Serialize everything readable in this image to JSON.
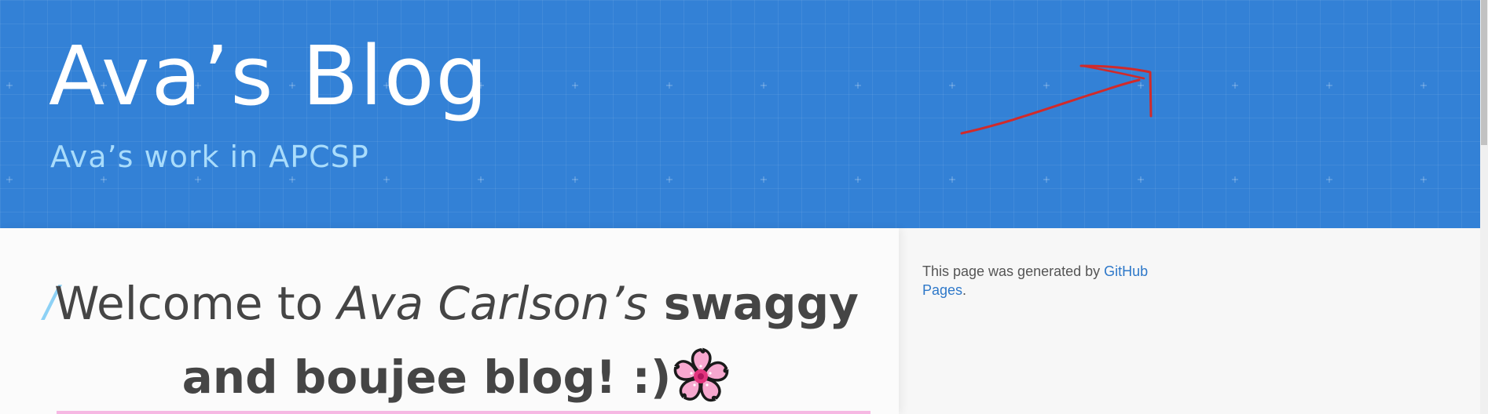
{
  "header": {
    "title": "Ava’s Blog",
    "subtitle": "Ava’s work in APCSP",
    "background_color": "#3381d6",
    "subtitle_color": "#a9dcfb"
  },
  "post": {
    "heading_part1": "Welcome to ",
    "heading_part2": "Ava Carlson’s",
    "heading_part3": " swaggy and boujee blog! :)",
    "heading_icon": "cherry-blossom-icon",
    "slash_icon": "slash-decoration-icon"
  },
  "sidebar": {
    "generated_text": "This page was generated by ",
    "link_text": "GitHub Pages",
    "period": "."
  },
  "colors": {
    "link": "#2e78c9",
    "accent_rule": "#f6b8e3",
    "arrow": "#d12a2a"
  }
}
